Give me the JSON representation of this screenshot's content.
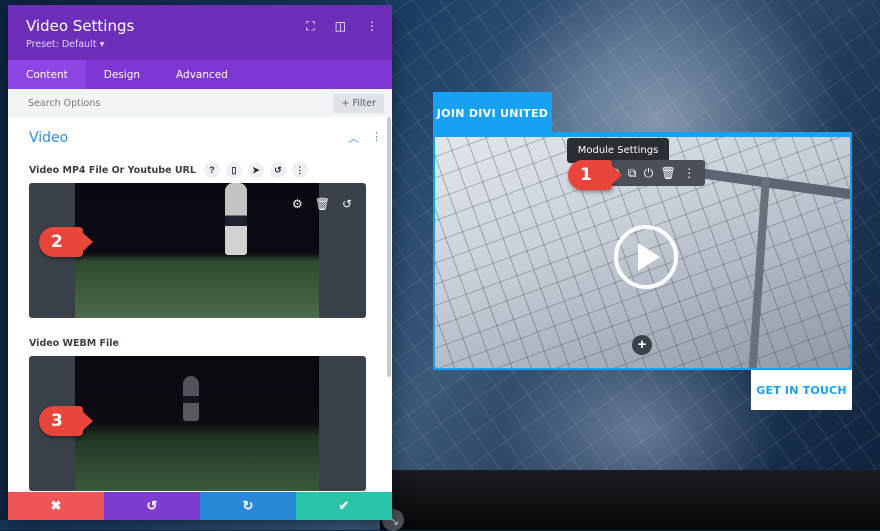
{
  "panel": {
    "title": "Video Settings",
    "preset": "Preset: Default ▾",
    "header_icons": [
      "focus-icon",
      "split-view-icon",
      "more-icon"
    ],
    "tabs": [
      {
        "label": "Content",
        "active": true
      },
      {
        "label": "Design",
        "active": false
      },
      {
        "label": "Advanced",
        "active": false
      }
    ],
    "search": {
      "placeholder": "Search Options",
      "value": ""
    },
    "filter_label": "+ Filter",
    "section": {
      "title": "Video",
      "fields": [
        {
          "label": "Video MP4 File Or Youtube URL",
          "icons": [
            "?",
            "▯",
            "➤",
            "↺",
            "⋮"
          ],
          "marker": "2"
        },
        {
          "label": "Video WEBM File",
          "icons": [],
          "marker": "3"
        }
      ]
    },
    "preview_controls": {
      "settings": "⚙",
      "delete": "🗑",
      "reset": "↺"
    },
    "footer": {
      "cancel": "✖",
      "undo": "↺",
      "redo": "↻",
      "save": "✔"
    }
  },
  "page": {
    "join_tab_label": "JOIN DIVI UNITED",
    "tooltip": "Module Settings",
    "module_toolbar": {
      "settings": "⚙",
      "duplicate": "⧉",
      "toggle": "⏻",
      "delete": "🗑",
      "more": "⋮"
    },
    "marker_1": "1",
    "add_label": "+",
    "cta_label": "GET IN TOUCH"
  },
  "colors": {
    "panel_header": "#6c2eb9",
    "tabs_bg": "#7d35d3",
    "accent_blue": "#16a1f2",
    "section_title": "#2c8ed8",
    "marker": "#e9453a",
    "cancel": "#ef5555",
    "undo": "#7e3bd0",
    "redo": "#2b87da",
    "save": "#29c4a9"
  }
}
